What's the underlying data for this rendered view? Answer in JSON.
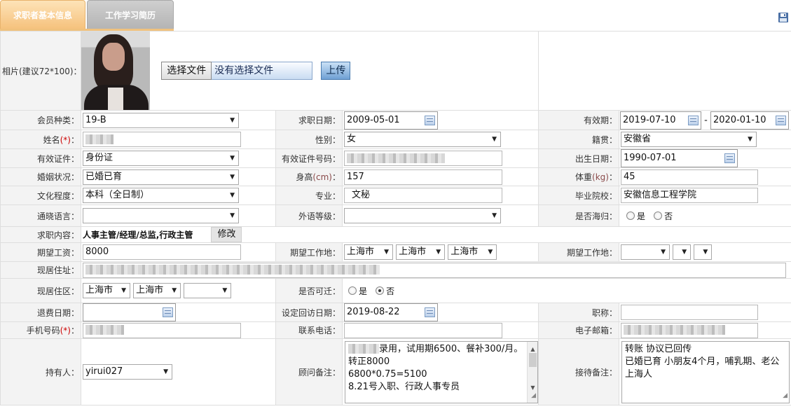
{
  "tabs": {
    "basic": "求职者基本信息",
    "history": "工作学习简历"
  },
  "colors": {
    "tab_active": "#f6c27d",
    "tab_inactive": "#b4b4b4",
    "label_bg": "#f3f3f3",
    "required": "#cc0000"
  },
  "photo": {
    "label": "相片(建议72*100)：",
    "choose_file": "选择文件",
    "no_file": "没有选择文件",
    "upload": "上传"
  },
  "fields": {
    "member_type": {
      "label": "会员种类：",
      "value": "19-B"
    },
    "apply_date": {
      "label": "求职日期：",
      "value": "2009-05-01"
    },
    "valid_period": {
      "label": "有效期：",
      "from": "2019-07-10",
      "sep": "-",
      "to": "2020-01-10"
    },
    "name": {
      "label": "姓名",
      "req": "(*)",
      "colon": "："
    },
    "gender": {
      "label": "性别：",
      "value": "女"
    },
    "native": {
      "label": "籍贯：",
      "value": "安徽省"
    },
    "id_type": {
      "label": "有效证件：",
      "value": "身份证"
    },
    "id_number": {
      "label": "有效证件号码："
    },
    "birth": {
      "label": "出生日期：",
      "value": "1990-07-01"
    },
    "marital": {
      "label": "婚姻状况：",
      "value": "已婚已育"
    },
    "height": {
      "label": "身高",
      "unit": "(cm)",
      "colon": "：",
      "value": "157"
    },
    "weight": {
      "label": "体重",
      "unit": "(kg)",
      "colon": "：",
      "value": "45"
    },
    "education": {
      "label": "文化程度：",
      "value": "本科（全日制）"
    },
    "major": {
      "label": "专业：",
      "value": "文秘"
    },
    "school": {
      "label": "毕业院校：",
      "value": "安徽信息工程学院"
    },
    "language": {
      "label": "通晓语言：",
      "value": ""
    },
    "foreign_level": {
      "label": "外语等级：",
      "value": ""
    },
    "returnee": {
      "label": "是否海归：",
      "yes": "是",
      "no": "否"
    },
    "job_content": {
      "label": "求职内容：",
      "value": "人事主管/经理/总监,行政主管",
      "edit": "修改"
    },
    "salary": {
      "label": "期望工资：",
      "value": "8000"
    },
    "work_place1": {
      "label": "期望工作地：",
      "v1": "上海市",
      "v2": "上海市",
      "v3": "上海市"
    },
    "work_place2": {
      "label": "期望工作地："
    },
    "address": {
      "label": "现居住址："
    },
    "district": {
      "label": "现居住区：",
      "v1": "上海市",
      "v2": "上海市"
    },
    "relocate": {
      "label": "是否可迁：",
      "yes": "是",
      "no": "否",
      "selected": "no"
    },
    "refund_date": {
      "label": "退费日期：",
      "value": ""
    },
    "revisit_date": {
      "label": "设定回访日期：",
      "value": "2019-08-22"
    },
    "title": {
      "label": "职称：",
      "value": ""
    },
    "mobile": {
      "label": "手机号码",
      "req": "(*)",
      "colon": "："
    },
    "phone": {
      "label": "联系电话：",
      "value": ""
    },
    "email": {
      "label": "电子邮箱："
    },
    "holder": {
      "label": "持有人：",
      "value": "yirui027"
    },
    "consultant_note": {
      "label": "顾问备注：",
      "line1": "录用，试用期6500、餐补300/月。转正8000",
      "line2": "6800*0.75=5100",
      "line3": "8.21号入职、行政人事专员"
    },
    "reception_note": {
      "label": "接待备注：",
      "line1": "转账 协议已回传",
      "line2": "已婚已育 小朋友4个月，哺乳期、老公上海人"
    }
  }
}
